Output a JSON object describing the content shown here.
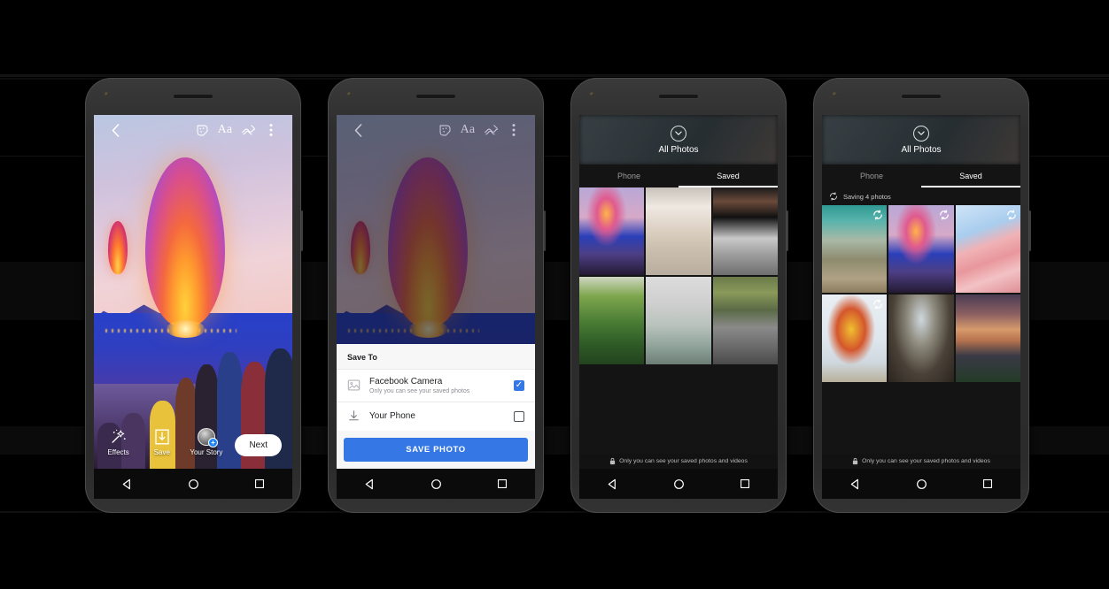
{
  "editor": {
    "topbar": {
      "back_icon": "chevron-left-icon",
      "sticker_icon": "sticker-icon",
      "text_label": "Aa",
      "draw_icon": "squiggle-draw-icon",
      "menu_icon": "overflow-menu-icon"
    },
    "tools": [
      {
        "label": "Effects",
        "icon": "magic-wand-icon"
      },
      {
        "label": "Save",
        "icon": "download-save-icon"
      },
      {
        "label": "Your Story",
        "icon": "avatar-plus-icon"
      }
    ],
    "next_label": "Next"
  },
  "save_sheet": {
    "title": "Save To",
    "options": [
      {
        "label": "Facebook Camera",
        "sublabel": "Only you can see your saved photos",
        "icon": "photo-frame-icon",
        "checked": true
      },
      {
        "label": "Your Phone",
        "sublabel": "",
        "icon": "download-save-icon",
        "checked": false
      }
    ],
    "button_label": "SAVE PHOTO"
  },
  "gallery": {
    "header_title": "All Photos",
    "header_icon": "chevron-down-circle-icon",
    "tabs": [
      {
        "label": "Phone",
        "active": false
      },
      {
        "label": "Saved",
        "active": true
      }
    ],
    "privacy_notice": "Only you can see your saved photos and videos",
    "privacy_icon": "lock-icon",
    "photos_saved": [
      {
        "name": "lantern-festival",
        "class": "im-lantern"
      },
      {
        "name": "newspaper-wall",
        "class": "im-wall"
      },
      {
        "name": "city-street-art",
        "class": "im-street"
      },
      {
        "name": "green-hills",
        "class": "im-hills"
      },
      {
        "name": "father-and-child",
        "class": "im-family"
      },
      {
        "name": "marathon-runners",
        "class": "im-runners"
      }
    ]
  },
  "gallery_syncing": {
    "header_title": "All Photos",
    "header_icon": "chevron-down-circle-icon",
    "tabs": [
      {
        "label": "Phone",
        "active": false
      },
      {
        "label": "Saved",
        "active": true
      }
    ],
    "status_text": "Saving 4 photos",
    "status_icon": "sync-icon",
    "sync_badge_icon": "sync-icon",
    "privacy_notice": "Only you can see your saved photos and videos",
    "privacy_icon": "lock-icon",
    "photos_saving": [
      {
        "name": "mountain-valley-hiker",
        "class": "im-valley",
        "syncing": true
      },
      {
        "name": "lantern-festival",
        "class": "im-lantern",
        "syncing": true
      },
      {
        "name": "pink-architecture",
        "class": "im-pink",
        "syncing": true
      },
      {
        "name": "hot-air-balloon",
        "class": "im-balloon",
        "syncing": true
      },
      {
        "name": "stone-tunnel-crowd",
        "class": "im-tunnel",
        "syncing": false
      },
      {
        "name": "dusk-stadium",
        "class": "im-dusk",
        "syncing": false
      }
    ]
  },
  "android_nav": {
    "back_icon": "android-back-icon",
    "home_icon": "android-home-icon",
    "recents_icon": "android-recents-icon"
  },
  "colors": {
    "accent_blue": "#3578e5",
    "badge_blue": "#1b84ff",
    "background": "#000000",
    "frame": "#2e2e2e"
  }
}
